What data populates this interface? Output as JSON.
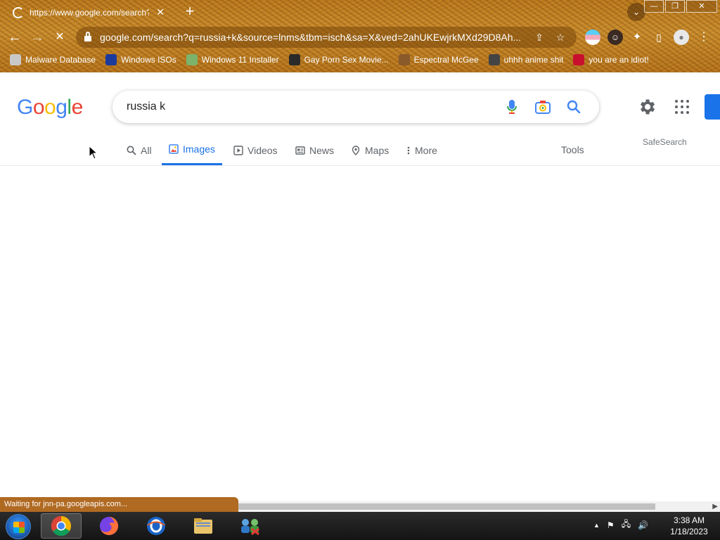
{
  "browser": {
    "tab_title": "https://www.google.com/search?q",
    "new_tab_label": "+",
    "url": "google.com/search?q=russia+k&source=lnms&tbm=isch&sa=X&ved=2ahUKEwjrkMXd29D8Ah...",
    "bookmarks": [
      {
        "label": "Malware Database",
        "icon": "blank",
        "color": "#c8c8c8"
      },
      {
        "label": "Windows ISOs",
        "icon": "x-logo",
        "color": "#1b3a9c"
      },
      {
        "label": "Windows 11 Installer",
        "icon": "image",
        "color": "#7bb36b"
      },
      {
        "label": "Gay Porn Sex Movie...",
        "icon": "site",
        "color": "#2a2a2a"
      },
      {
        "label": "Espectral McGee",
        "icon": "avatar",
        "color": "#8b5a2b"
      },
      {
        "label": "uhhh anime shit",
        "icon": "avatar",
        "color": "#444444"
      },
      {
        "label": "you are an idiot!",
        "icon": "flag",
        "color": "#c8102e"
      }
    ]
  },
  "google": {
    "logo_letters": [
      {
        "ch": "G",
        "color": "#4285F4"
      },
      {
        "ch": "o",
        "color": "#EA4335"
      },
      {
        "ch": "o",
        "color": "#FBBC05"
      },
      {
        "ch": "g",
        "color": "#4285F4"
      },
      {
        "ch": "l",
        "color": "#34A853"
      },
      {
        "ch": "e",
        "color": "#EA4335"
      }
    ],
    "query": "russia k",
    "tabs": [
      {
        "label": "All",
        "icon": "search-icon",
        "active": false
      },
      {
        "label": "Images",
        "icon": "image-icon",
        "active": true
      },
      {
        "label": "Videos",
        "icon": "play-icon",
        "active": false
      },
      {
        "label": "News",
        "icon": "newspaper-icon",
        "active": false
      },
      {
        "label": "Maps",
        "icon": "map-pin-icon",
        "active": false
      },
      {
        "label": "More",
        "icon": "more-vert-icon",
        "active": false
      }
    ],
    "tools_label": "Tools",
    "safesearch_label": "SafeSearch"
  },
  "status_text": "Waiting for jnn-pa.googleapis.com...",
  "taskbar": {
    "time": "3:38 AM",
    "date": "1/18/2023",
    "tray_chevron": "▲"
  },
  "colors": {
    "accent_blue": "#1a73e8",
    "tab_gray": "#5f6368"
  }
}
